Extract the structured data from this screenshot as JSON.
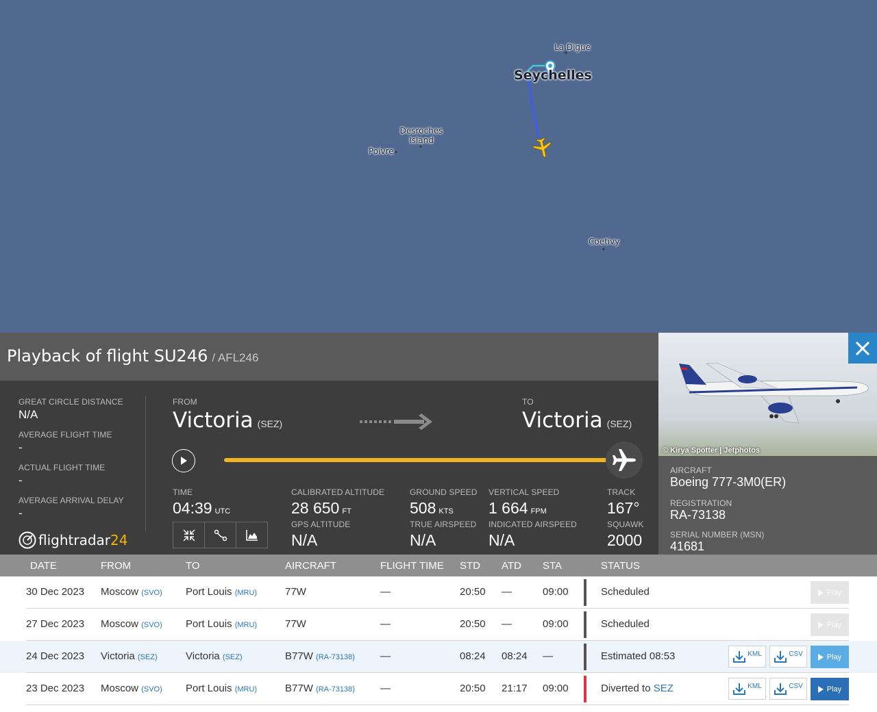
{
  "map": {
    "labels": [
      "La Digue",
      "Seychelles",
      "Desroches Island",
      "Poivre",
      "Coetivy"
    ]
  },
  "panel": {
    "title": "Playback of flight SU246",
    "subtitle": "/ AFL246",
    "great_circle_label": "GREAT CIRCLE DISTANCE",
    "great_circle_value": "N/A",
    "avg_flight_time_label": "AVERAGE FLIGHT TIME",
    "avg_flight_time_value": "-",
    "actual_flight_time_label": "ACTUAL FLIGHT TIME",
    "actual_flight_time_value": "-",
    "avg_arrival_delay_label": "AVERAGE ARRIVAL DELAY",
    "avg_arrival_delay_value": "-",
    "logo_text": "flightradar",
    "logo_num": "24",
    "from_label": "FROM",
    "from_city": "Victoria",
    "from_code": "(SEZ)",
    "to_label": "TO",
    "to_city": "Victoria",
    "to_code": "(SEZ)",
    "progress": 1.0,
    "time_label": "TIME",
    "time_value": "04:39",
    "time_unit": "UTC",
    "cal_alt_label": "CALIBRATED ALTITUDE",
    "cal_alt_value": "28 650",
    "cal_alt_unit": "FT",
    "gps_alt_label": "GPS ALTITUDE",
    "gps_alt_value": "N/A",
    "ground_speed_label": "GROUND SPEED",
    "ground_speed_value": "508",
    "ground_speed_unit": "KTS",
    "true_airspeed_label": "TRUE AIRSPEED",
    "true_airspeed_value": "N/A",
    "vert_speed_label": "VERTICAL SPEED",
    "vert_speed_value": "1 664",
    "vert_speed_unit": "FPM",
    "ind_airspeed_label": "INDICATED AIRSPEED",
    "ind_airspeed_value": "N/A",
    "track_label": "TRACK",
    "track_value": "167°",
    "squawk_label": "SQUAWK",
    "squawk_value": "2000"
  },
  "aircraft": {
    "photo_credit": "© Kirya Spotter | Jetphotos",
    "aircraft_label": "AIRCRAFT",
    "aircraft_value": "Boeing 777-3M0(ER)",
    "registration_label": "REGISTRATION",
    "registration_value": "RA-73138",
    "serial_label": "SERIAL NUMBER (MSN)",
    "serial_value": "41681"
  },
  "table": {
    "headers": [
      "DATE",
      "FROM",
      "TO",
      "AIRCRAFT",
      "FLIGHT TIME",
      "STD",
      "ATD",
      "STA",
      "STATUS"
    ],
    "rows": [
      {
        "date": "30 Dec 2023",
        "from": "Moscow",
        "from_code": "(SVO)",
        "to": "Port Louis",
        "to_code": "(MRU)",
        "aircraft": "77W",
        "reg": "",
        "flight_time": "—",
        "std": "20:50",
        "atd": "—",
        "sta": "09:00",
        "status": "Scheduled",
        "status_link": "",
        "kml": "",
        "csv": "",
        "play": "Play"
      },
      {
        "date": "27 Dec 2023",
        "from": "Moscow",
        "from_code": "(SVO)",
        "to": "Port Louis",
        "to_code": "(MRU)",
        "aircraft": "77W",
        "reg": "",
        "flight_time": "—",
        "std": "20:50",
        "atd": "—",
        "sta": "09:00",
        "status": "Scheduled",
        "status_link": "",
        "kml": "",
        "csv": "",
        "play": "Play"
      },
      {
        "date": "24 Dec 2023",
        "from": "Victoria",
        "from_code": "(SEZ)",
        "to": "Victoria",
        "to_code": "(SEZ)",
        "aircraft": "B77W",
        "reg": "(RA-73138)",
        "flight_time": "—",
        "std": "08:24",
        "atd": "08:24",
        "sta": "—",
        "status": "Estimated 08:53",
        "status_link": "",
        "kml": "KML",
        "csv": "CSV",
        "play": "Play"
      },
      {
        "date": "23 Dec 2023",
        "from": "Moscow",
        "from_code": "(SVO)",
        "to": "Port Louis",
        "to_code": "(MRU)",
        "aircraft": "B77W",
        "reg": "(RA-73138)",
        "flight_time": "—",
        "std": "20:50",
        "atd": "21:17",
        "sta": "09:00",
        "status": "Diverted to",
        "status_link": "SEZ",
        "kml": "KML",
        "csv": "CSV",
        "play": "Play"
      }
    ]
  }
}
